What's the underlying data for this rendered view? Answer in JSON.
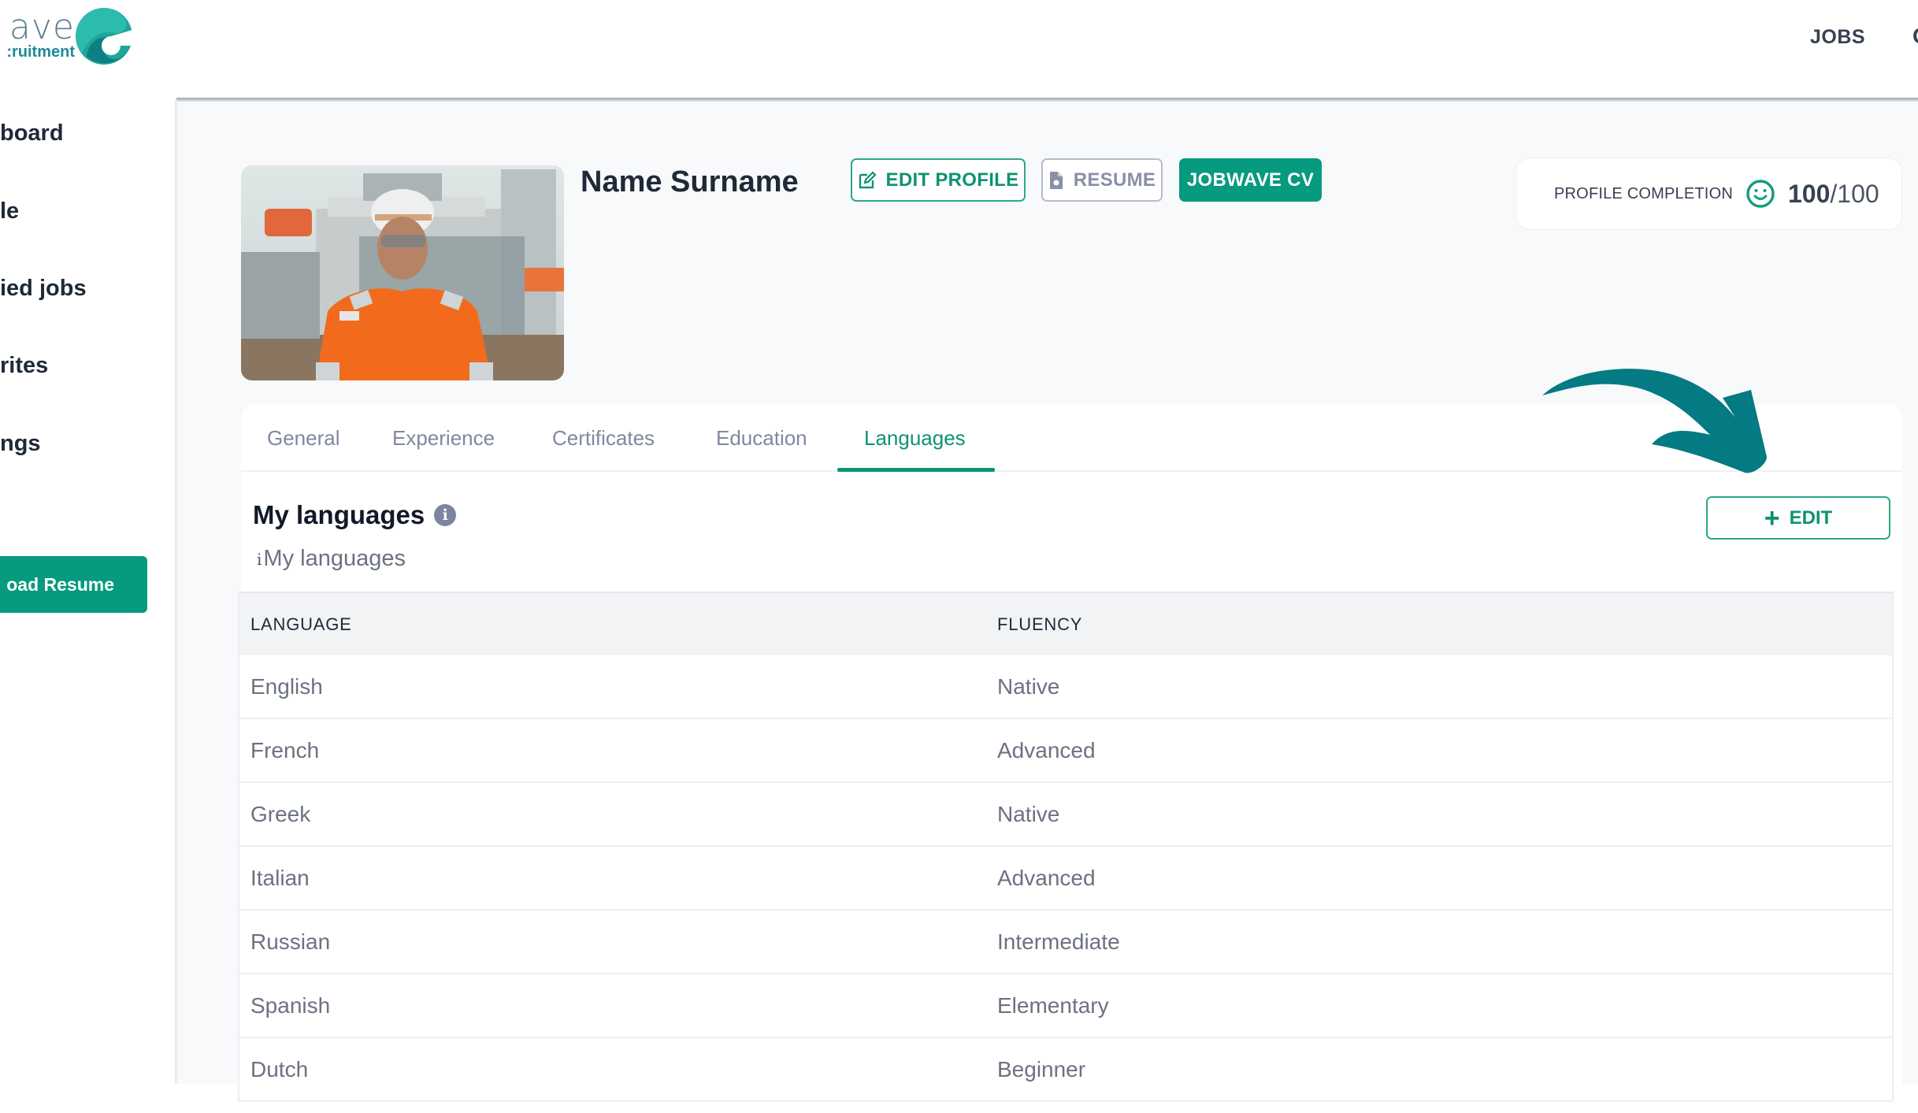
{
  "brand": {
    "logo_word": "ave",
    "logo_sub": ":ruitment",
    "colors": {
      "primary": "#069a7e",
      "accent_teal": "#047a82",
      "tab_active": "#0d9373",
      "muted": "#8088a0"
    }
  },
  "topnav": {
    "items": [
      {
        "label": "JOBS"
      }
    ],
    "cut_item_glyph": "C"
  },
  "sidebar": {
    "items": [
      {
        "label": "board"
      },
      {
        "label": "le"
      },
      {
        "label": "ied jobs"
      },
      {
        "label": "rites"
      },
      {
        "label": "ngs"
      }
    ],
    "upload_button": "oad Resume"
  },
  "profile": {
    "name": "Name Surname",
    "photo_alt": "Worker in orange coverall and white hard hat on ship deck",
    "buttons": {
      "edit_profile": "EDIT PROFILE",
      "resume": "RESUME",
      "jobwave_cv": "JOBWAVE CV"
    },
    "completion": {
      "label": "PROFILE COMPLETION",
      "score": "100",
      "max": "/100",
      "icon": "smiley-icon"
    }
  },
  "tabs": [
    {
      "label": "General",
      "active": false
    },
    {
      "label": "Experience",
      "active": false
    },
    {
      "label": "Certificates",
      "active": false
    },
    {
      "label": "Education",
      "active": false
    },
    {
      "label": "Languages",
      "active": true
    }
  ],
  "languages_section": {
    "title": "My languages",
    "info_glyph": "i",
    "subtitle_glyph": "i",
    "subtitle": "My languages",
    "edit_button": "EDIT",
    "edit_icon": "+",
    "table": {
      "headers": [
        "LANGUAGE",
        "FLUENCY"
      ],
      "rows": [
        {
          "language": "English",
          "fluency": "Native"
        },
        {
          "language": "French",
          "fluency": "Advanced"
        },
        {
          "language": "Greek",
          "fluency": "Native"
        },
        {
          "language": "Italian",
          "fluency": "Advanced"
        },
        {
          "language": "Russian",
          "fluency": "Intermediate"
        },
        {
          "language": "Spanish",
          "fluency": "Elementary"
        },
        {
          "language": "Dutch",
          "fluency": "Beginner"
        }
      ]
    }
  },
  "annotation": {
    "type": "curved-arrow-pointing-to-edit",
    "color": "#047a82"
  }
}
